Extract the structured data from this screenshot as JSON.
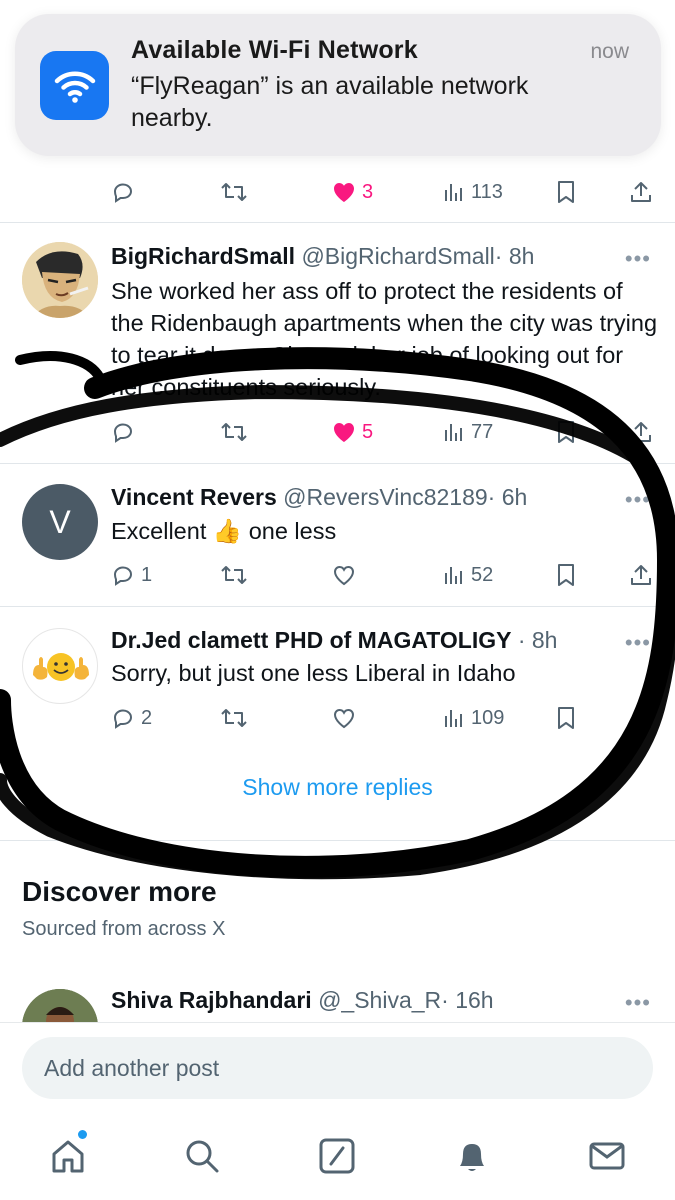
{
  "notification": {
    "title": "Available Wi-Fi Network",
    "body": "“FlyReagan” is an available network nearby.",
    "time": "now",
    "icon": "wifi-icon",
    "accent": "#1877f2"
  },
  "first_actions": {
    "likes": "3",
    "views": "113"
  },
  "replies": [
    {
      "name": "BigRichardSmall",
      "handle": "@BigRichardSmall",
      "time": "· 8h",
      "text": "She worked her ass off to protect the residents of the Ridenbaugh apartments when the city was trying to tear it down. She took her job of looking out for her constituents seriously.",
      "replies": "",
      "likes": "5",
      "views": "77",
      "liked": true
    },
    {
      "name": "Vincent Revers",
      "handle": "@ReversVinc82189",
      "time": "· 6h",
      "text_before": "Excellent",
      "emoji": "👍",
      "text_after": "one less",
      "avatar_letter": "V",
      "replies": "1",
      "likes": "",
      "views": "52"
    },
    {
      "name": "Dr.Jed clamett PHD of MAGATOLIGY",
      "handle": "",
      "time": "· 8h",
      "text": "Sorry, but just one less Liberal in Idaho",
      "replies": "2",
      "likes": "",
      "views": "109"
    }
  ],
  "show_more": "Show more replies",
  "discover": {
    "title": "Discover more",
    "subtitle": "Sourced from across X",
    "next_name": "Shiva Rajbhandari",
    "next_handle": "@_Shiva_R",
    "next_time": "· 16h"
  },
  "composer": {
    "placeholder": "Add another post"
  },
  "more_glyph": "•••",
  "colors": {
    "like": "#f91880",
    "link": "#1d9bf0",
    "muted": "#536471",
    "scribble": "#000000"
  }
}
